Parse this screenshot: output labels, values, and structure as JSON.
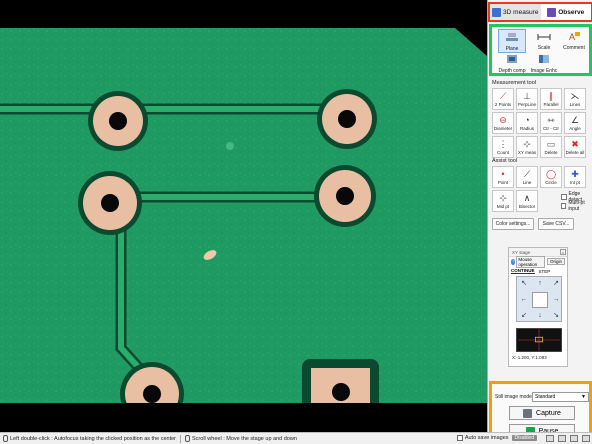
{
  "tabs": [
    {
      "label": "3D measure",
      "icon": "cube-icon",
      "active": false
    },
    {
      "label": "Observe",
      "icon": "observe-icon",
      "active": true
    }
  ],
  "modes": [
    {
      "label": "Plane",
      "icon": "plane-icon",
      "selected": true
    },
    {
      "label": "Scale",
      "icon": "scale-icon",
      "selected": false
    },
    {
      "label": "Comment",
      "icon": "comment-icon",
      "selected": false
    },
    {
      "label": "Depth comp",
      "icon": "depth-icon",
      "selected": false
    },
    {
      "label": "Image Enhc",
      "icon": "enhance-icon",
      "selected": false
    }
  ],
  "measurement": {
    "title": "Measurement tool",
    "tools": [
      "2 Points",
      "PerpLine",
      "Parallel",
      "Lines",
      "Diameter",
      "Radius",
      "Ctr - Ctr",
      "Angle",
      "Count",
      "XY meas",
      "Delete",
      "Delete all"
    ]
  },
  "assist": {
    "title": "Assist tool",
    "tools": [
      "Point",
      "Line",
      "Circle",
      "Int pt",
      "Mid pt",
      "Bisector"
    ],
    "checks": [
      "Edge detect",
      "Multi-pt input"
    ]
  },
  "buttons": {
    "color_settings": "Color settings...",
    "save_csv": "Save CSV..."
  },
  "xy_stage": {
    "title": "XY stage",
    "mouse_operation": "Mouse operation",
    "origin": "Origin",
    "modes": [
      "CONTINUE",
      "STEP"
    ],
    "coords": "X:-1.200, Y:1.083"
  },
  "capture": {
    "mode_label": "Still image mode :",
    "mode_value": "Standard",
    "capture_label": "Capture",
    "pause_label": "Pause"
  },
  "status": {
    "left_hint": "Left double-click : Autofocus taking the clicked position as the center",
    "scroll_hint": "Scroll wheel : Move the stage up and down",
    "autosave_label": "Auto save images",
    "autosave_state": "Disabled"
  },
  "colors": {
    "pcb_green": "#1f9a63",
    "pad_copper": "#e9bfa4",
    "frame_red": "#e53a1e",
    "frame_green": "#22c55e",
    "frame_orange": "#f59e0b"
  }
}
